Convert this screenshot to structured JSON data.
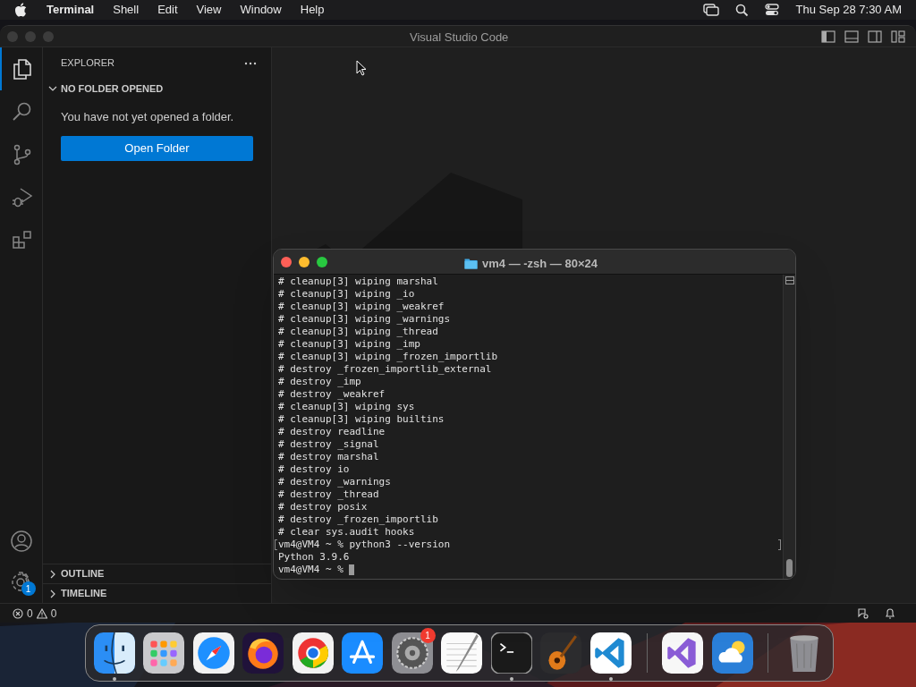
{
  "menu_bar": {
    "app": "Terminal",
    "items": [
      "Shell",
      "Edit",
      "View",
      "Window",
      "Help"
    ],
    "clock": "Thu Sep 28  7:30 AM"
  },
  "vscode": {
    "title": "Visual Studio Code",
    "activity_bar": [
      {
        "kind": "explorer",
        "selected": true
      },
      {
        "kind": "search",
        "selected": false
      },
      {
        "kind": "source-control",
        "selected": false
      },
      {
        "kind": "run-debug",
        "selected": false
      },
      {
        "kind": "extensions",
        "selected": false
      }
    ],
    "manage_badge": "1",
    "sidebar": {
      "title": "EXPLORER",
      "section": {
        "title": "NO FOLDER OPENED",
        "expanded": true
      },
      "message": "You have not yet opened a folder.",
      "button": "Open Folder",
      "panels": [
        {
          "title": "OUTLINE",
          "expanded": false
        },
        {
          "title": "TIMELINE",
          "expanded": false
        }
      ]
    },
    "status_bar": {
      "errors": "0",
      "warnings": "0"
    }
  },
  "terminal": {
    "title": "vm4 — -zsh — 80×24",
    "lines": [
      {
        "text": "# cleanup[3] wiping marshal",
        "marked": false
      },
      {
        "text": "# cleanup[3] wiping _io",
        "marked": false
      },
      {
        "text": "# cleanup[3] wiping _weakref",
        "marked": false
      },
      {
        "text": "# cleanup[3] wiping _warnings",
        "marked": false
      },
      {
        "text": "# cleanup[3] wiping _thread",
        "marked": false
      },
      {
        "text": "# cleanup[3] wiping _imp",
        "marked": false
      },
      {
        "text": "# cleanup[3] wiping _frozen_importlib",
        "marked": false
      },
      {
        "text": "# destroy _frozen_importlib_external",
        "marked": false
      },
      {
        "text": "# destroy _imp",
        "marked": false
      },
      {
        "text": "# destroy _weakref",
        "marked": false
      },
      {
        "text": "# cleanup[3] wiping sys",
        "marked": false
      },
      {
        "text": "# cleanup[3] wiping builtins",
        "marked": false
      },
      {
        "text": "# destroy readline",
        "marked": false
      },
      {
        "text": "# destroy _signal",
        "marked": false
      },
      {
        "text": "# destroy marshal",
        "marked": false
      },
      {
        "text": "# destroy io",
        "marked": false
      },
      {
        "text": "# destroy _warnings",
        "marked": false
      },
      {
        "text": "# destroy _thread",
        "marked": false
      },
      {
        "text": "# destroy posix",
        "marked": false
      },
      {
        "text": "# destroy _frozen_importlib",
        "marked": false
      },
      {
        "text": "# clear sys.audit hooks",
        "marked": false
      },
      {
        "text": "vm4@VM4 ~ % python3 --version",
        "marked": true
      },
      {
        "text": "Python 3.9.6",
        "marked": false
      },
      {
        "text": "vm4@VM4 ~ % ",
        "marked": false,
        "cursor": true
      }
    ]
  },
  "dock": [
    {
      "kind": "finder",
      "running": true
    },
    {
      "kind": "launchpad",
      "running": false
    },
    {
      "kind": "safari",
      "running": false
    },
    {
      "kind": "firefox",
      "running": false
    },
    {
      "kind": "chrome",
      "running": false
    },
    {
      "kind": "appstore",
      "running": false
    },
    {
      "kind": "settings",
      "running": false,
      "badge": "1"
    },
    {
      "kind": "textedit",
      "running": false
    },
    {
      "kind": "terminal",
      "running": true
    },
    {
      "kind": "garageband",
      "running": false
    },
    {
      "kind": "vscode",
      "running": true
    },
    {
      "kind": "separator"
    },
    {
      "kind": "visualstudio",
      "running": false
    },
    {
      "kind": "weather",
      "running": false
    },
    {
      "kind": "separator"
    },
    {
      "kind": "trash",
      "running": false
    }
  ]
}
